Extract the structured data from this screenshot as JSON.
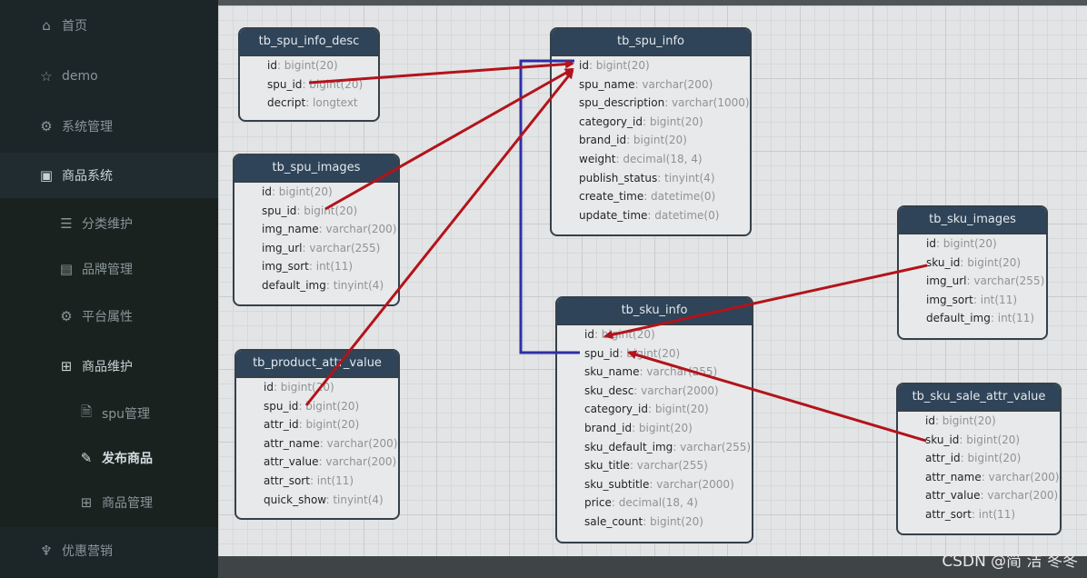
{
  "sidebar": {
    "items": [
      {
        "label": "首页",
        "icon": "home-icon",
        "glyph": "⌂"
      },
      {
        "label": "demo",
        "icon": "star-icon",
        "glyph": "☆"
      },
      {
        "label": "系统管理",
        "icon": "gear-icon",
        "glyph": "⚙"
      },
      {
        "label": "商品系统",
        "icon": "product-system-icon",
        "glyph": "▣"
      },
      {
        "label": "分类维护",
        "icon": "list-icon",
        "glyph": "☰"
      },
      {
        "label": "品牌管理",
        "icon": "brand-icon",
        "glyph": "▤"
      },
      {
        "label": "平台属性",
        "icon": "settings-icon",
        "glyph": "⚙"
      },
      {
        "label": "商品维护",
        "icon": "grid-icon",
        "glyph": "⊞"
      },
      {
        "label": "spu管理",
        "icon": "spu-doc-icon",
        "glyph": "🗎"
      },
      {
        "label": "发布商品",
        "icon": "edit-icon",
        "glyph": "✎"
      },
      {
        "label": "商品管理",
        "icon": "grid-icon",
        "glyph": "⊞"
      },
      {
        "label": "优惠营销",
        "icon": "promotion-icon",
        "glyph": "♆"
      }
    ]
  },
  "tables": {
    "spu_info_desc": {
      "title": "tb_spu_info_desc",
      "fields": [
        {
          "name": "id",
          "type": ": bigint(20)"
        },
        {
          "name": "spu_id",
          "type": ": bigint(20)"
        },
        {
          "name": "decript",
          "type": ": longtext"
        }
      ]
    },
    "spu_images": {
      "title": "tb_spu_images",
      "fields": [
        {
          "name": "id",
          "type": ": bigint(20)"
        },
        {
          "name": "spu_id",
          "type": ": bigint(20)"
        },
        {
          "name": "img_name",
          "type": ": varchar(200)"
        },
        {
          "name": "img_url",
          "type": ": varchar(255)"
        },
        {
          "name": "img_sort",
          "type": ": int(11)"
        },
        {
          "name": "default_img",
          "type": ": tinyint(4)"
        }
      ]
    },
    "product_attr_value": {
      "title": "tb_product_attr_value",
      "fields": [
        {
          "name": "id",
          "type": ": bigint(20)"
        },
        {
          "name": "spu_id",
          "type": ": bigint(20)"
        },
        {
          "name": "attr_id",
          "type": ": bigint(20)"
        },
        {
          "name": "attr_name",
          "type": ": varchar(200)"
        },
        {
          "name": "attr_value",
          "type": ": varchar(200)"
        },
        {
          "name": "attr_sort",
          "type": ": int(11)"
        },
        {
          "name": "quick_show",
          "type": ": tinyint(4)"
        }
      ]
    },
    "spu_info": {
      "title": "tb_spu_info",
      "fields": [
        {
          "name": "id",
          "type": ": bigint(20)"
        },
        {
          "name": "spu_name",
          "type": ": varchar(200)"
        },
        {
          "name": "spu_description",
          "type": ": varchar(1000)"
        },
        {
          "name": "category_id",
          "type": ": bigint(20)"
        },
        {
          "name": "brand_id",
          "type": ": bigint(20)"
        },
        {
          "name": "weight",
          "type": ": decimal(18, 4)"
        },
        {
          "name": "publish_status",
          "type": ": tinyint(4)"
        },
        {
          "name": "create_time",
          "type": ": datetime(0)"
        },
        {
          "name": "update_time",
          "type": ": datetime(0)"
        }
      ]
    },
    "sku_info": {
      "title": "tb_sku_info",
      "fields": [
        {
          "name": "id",
          "type": ": bigint(20)"
        },
        {
          "name": "spu_id",
          "type": ": bigint(20)"
        },
        {
          "name": "sku_name",
          "type": ": varchar(255)"
        },
        {
          "name": "sku_desc",
          "type": ": varchar(2000)"
        },
        {
          "name": "category_id",
          "type": ": bigint(20)"
        },
        {
          "name": "brand_id",
          "type": ": bigint(20)"
        },
        {
          "name": "sku_default_img",
          "type": ": varchar(255)"
        },
        {
          "name": "sku_title",
          "type": ": varchar(255)"
        },
        {
          "name": "sku_subtitle",
          "type": ": varchar(2000)"
        },
        {
          "name": "price",
          "type": ": decimal(18, 4)"
        },
        {
          "name": "sale_count",
          "type": ": bigint(20)"
        }
      ]
    },
    "sku_images": {
      "title": "tb_sku_images",
      "fields": [
        {
          "name": "id",
          "type": ": bigint(20)"
        },
        {
          "name": "sku_id",
          "type": ": bigint(20)"
        },
        {
          "name": "img_url",
          "type": ": varchar(255)"
        },
        {
          "name": "img_sort",
          "type": ": int(11)"
        },
        {
          "name": "default_img",
          "type": ": int(11)"
        }
      ]
    },
    "sku_sale_attr_value": {
      "title": "tb_sku_sale_attr_value",
      "fields": [
        {
          "name": "id",
          "type": ": bigint(20)"
        },
        {
          "name": "sku_id",
          "type": ": bigint(20)"
        },
        {
          "name": "attr_id",
          "type": ": bigint(20)"
        },
        {
          "name": "attr_name",
          "type": ": varchar(200)"
        },
        {
          "name": "attr_value",
          "type": ": varchar(200)"
        },
        {
          "name": "attr_sort",
          "type": ": int(11)"
        }
      ]
    }
  },
  "colors": {
    "arrow": "#b3131b",
    "bracket": "#2d2fa8",
    "header": "#2f4458"
  },
  "watermark": "CSDN @简 洁 冬冬"
}
